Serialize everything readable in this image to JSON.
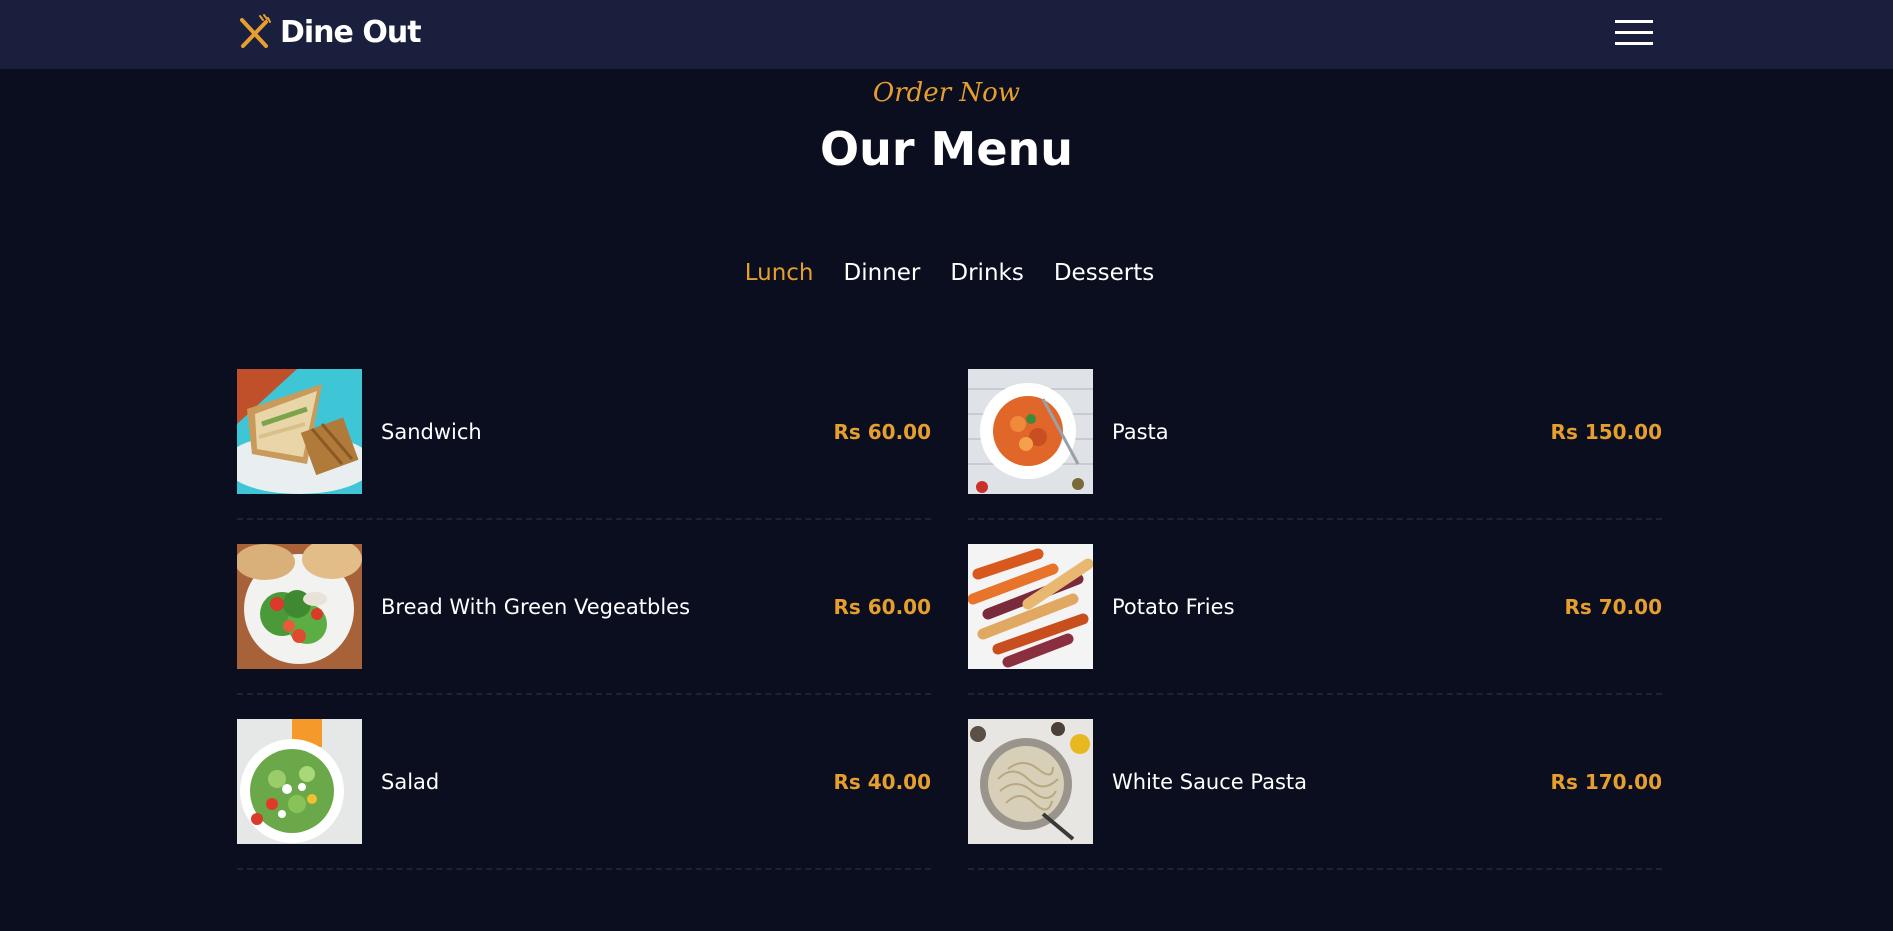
{
  "brand": {
    "name": "Dine Out",
    "icon": "fork-knife-icon",
    "accent_color": "#e69f2e"
  },
  "nav": {
    "menu_icon": "hamburger-menu-icon"
  },
  "section": {
    "subtitle": "Order Now",
    "title": "Our Menu"
  },
  "tabs": [
    {
      "label": "Lunch",
      "active": true
    },
    {
      "label": "Dinner",
      "active": false
    },
    {
      "label": "Drinks",
      "active": false
    },
    {
      "label": "Desserts",
      "active": false
    }
  ],
  "menu_items": [
    {
      "name": "Sandwich",
      "price": "Rs 60.00",
      "image": "sandwich-image"
    },
    {
      "name": "Pasta",
      "price": "Rs 150.00",
      "image": "pasta-image"
    },
    {
      "name": "Bread With Green Vegeatbles",
      "price": "Rs 60.00",
      "image": "bread-salad-image"
    },
    {
      "name": "Potato Fries",
      "price": "Rs 70.00",
      "image": "potato-fries-image"
    },
    {
      "name": "Salad",
      "price": "Rs 40.00",
      "image": "salad-image"
    },
    {
      "name": "White Sauce Pasta",
      "price": "Rs 170.00",
      "image": "white-sauce-pasta-image"
    }
  ],
  "colors": {
    "background": "#0a0e1f",
    "navbar": "#1a1f3d",
    "accent": "#e69f2e",
    "text": "#ffffff"
  }
}
